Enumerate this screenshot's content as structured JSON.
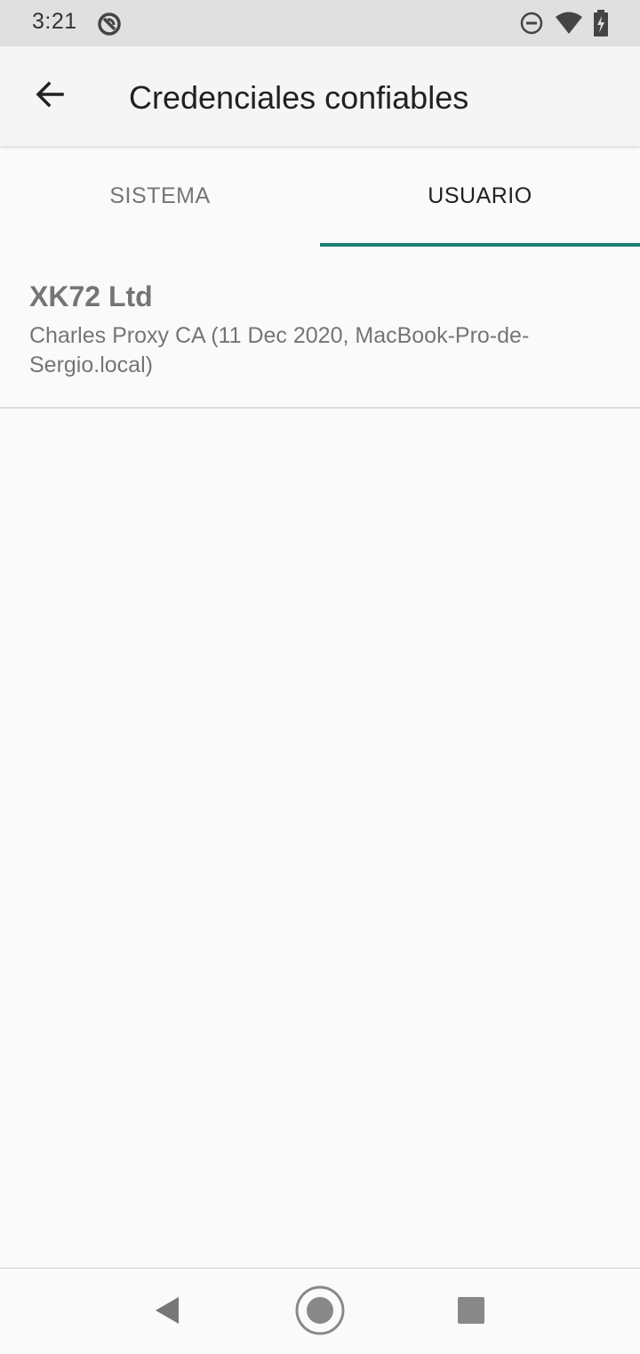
{
  "status_bar": {
    "time": "3:21",
    "icons": [
      "sync-disabled-icon",
      "do-not-disturb-icon",
      "wifi-icon",
      "battery-charging-icon"
    ]
  },
  "app_bar": {
    "back_icon": "arrow-back-icon",
    "title": "Credenciales confiables"
  },
  "tabs": [
    {
      "label": "SISTEMA",
      "selected": false
    },
    {
      "label": "USUARIO",
      "selected": true
    }
  ],
  "certificates": [
    {
      "title": "XK72 Ltd",
      "subtitle": "Charles Proxy CA (11 Dec 2020, MacBook-Pro-de-Sergio.local)"
    }
  ],
  "nav_bar": {
    "buttons": [
      "back-triangle-icon",
      "home-circle-icon",
      "recents-square-icon"
    ]
  },
  "colors": {
    "accent": "#1a7d73",
    "status_bar": "#e0e0e0",
    "background": "#fafafa"
  }
}
